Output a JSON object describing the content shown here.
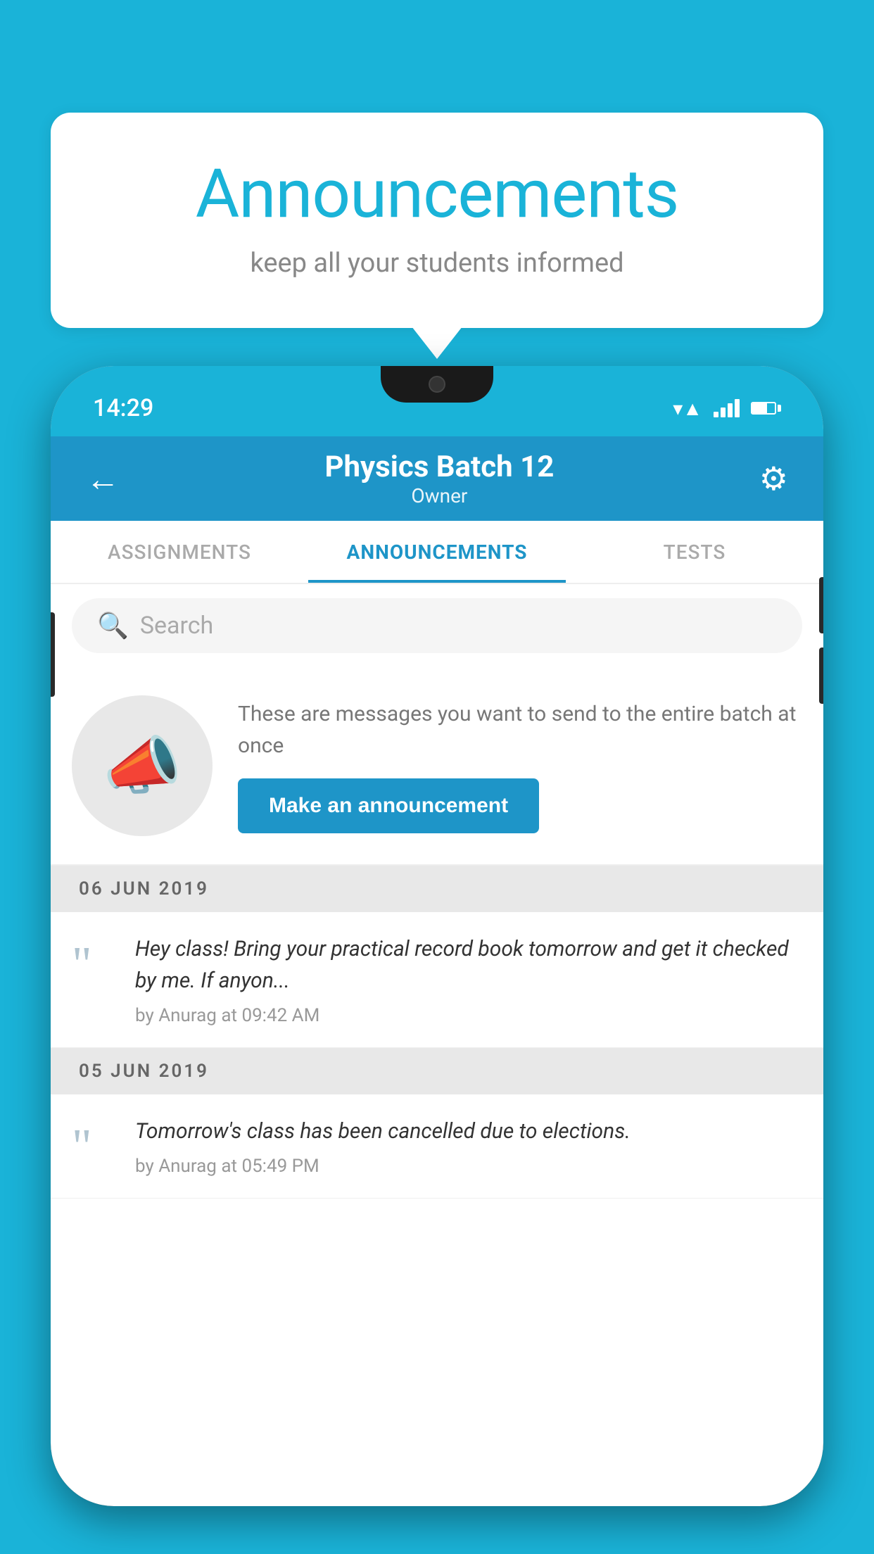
{
  "page": {
    "background_color": "#1ab3d8"
  },
  "speech_bubble": {
    "title": "Announcements",
    "subtitle": "keep all your students informed",
    "title_color": "#1ab3d8",
    "subtitle_color": "#888888"
  },
  "phone": {
    "status_bar": {
      "time": "14:29"
    },
    "header": {
      "batch_name": "Physics Batch 12",
      "role": "Owner",
      "back_label": "←",
      "gear_symbol": "⚙"
    },
    "tabs": [
      {
        "label": "ASSIGNMENTS",
        "active": false
      },
      {
        "label": "ANNOUNCEMENTS",
        "active": true
      },
      {
        "label": "TESTS",
        "active": false
      }
    ],
    "search": {
      "placeholder": "Search"
    },
    "promo": {
      "description": "These are messages you want to send to the entire batch at once",
      "button_label": "Make an announcement"
    },
    "announcements": [
      {
        "date": "06  JUN  2019",
        "text": "Hey class! Bring your practical record book tomorrow and get it checked by me. If anyon...",
        "author": "by Anurag at 09:42 AM"
      },
      {
        "date": "05  JUN  2019",
        "text": "Tomorrow's class has been cancelled due to elections.",
        "author": "by Anurag at 05:49 PM"
      }
    ]
  }
}
